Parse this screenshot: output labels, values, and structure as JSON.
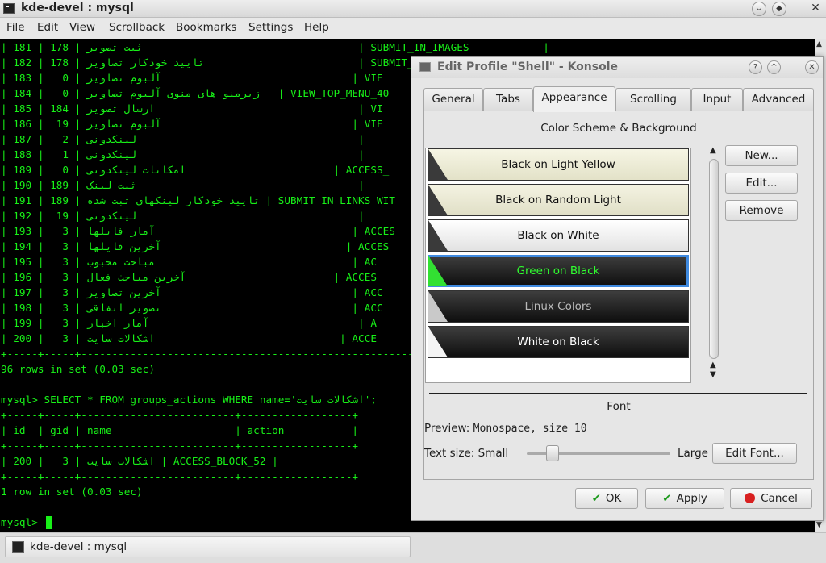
{
  "window": {
    "title": "kde-devel : mysql"
  },
  "menu": [
    "File",
    "Edit",
    "View",
    "Scrollback",
    "Bookmarks",
    "Settings",
    "Help"
  ],
  "terminal": {
    "lines": [
      "| 181 | 178 | ثبت تصویر                                   | SUBMIT_IN_IMAGES            |",
      "| 182 | 178 | تایید خودکار تصاویر                         | SUBMIT_IN_",
      "| 183 |   0 | آلبوم تصاویر                               | VIE",
      "| 184 |   0 | زیرمنو های منوی آلبوم تصاویر   | VIEW_TOP_MENU_40",
      "| 185 | 184 | ارسال تصویر                                 | VI",
      "| 186 |  19 | آلبوم تصاویر                               | VIE",
      "| 187 |   2 | لینکدونی                                    |",
      "| 188 |   1 | لینکدونی                                    |",
      "| 189 |   0 | امکانات لینکدونی                        | ACCESS_",
      "| 190 | 189 | ثبت لینک                                    |",
      "| 191 | 189 | تایید خودکار لینکهای ثبت شده | SUBMIT_IN_LINKS_WIT",
      "| 192 |  19 | لینکدونی                                    |",
      "| 193 |   3 | آمار فایلها                                | ACCES",
      "| 194 |   3 | آخرین فایلها                              | ACCES",
      "| 195 |   3 | مباحث محبوب                                | AC",
      "| 196 |   3 | آخرین مباحث فعال                        | ACCES",
      "| 197 |   3 | آخرین تصاویر                               | ACC",
      "| 198 |   3 | تصویر اتفاقی                               | ACC",
      "| 199 |   3 | آمار اخبار                                  | A",
      "| 200 |   3 | اشکالات سایت                              | ACCE",
      "+-----+-----+------------------------------------------------------------------",
      "96 rows in set (0.03 sec)",
      "",
      "mysql> SELECT * FROM groups_actions WHERE name='اشکالات سایت';",
      "+-----+-----+-------------------------+------------------+",
      "| id  | gid | name                    | action           |",
      "+-----+-----+-------------------------+------------------+",
      "| 200 |   3 | اشکالات سایت | ACCESS_BLOCK_52 |",
      "+-----+-----+-------------------------+------------------+",
      "1 row in set (0.03 sec)",
      "",
      "mysql> "
    ]
  },
  "taskbar": {
    "task_label": "kde-devel : mysql"
  },
  "dialog": {
    "title": "Edit Profile \"Shell\" - Konsole",
    "tabs": [
      "General",
      "Tabs",
      "Appearance",
      "Scrolling",
      "Input",
      "Advanced"
    ],
    "active_tab": "Appearance",
    "color_section_title": "Color Scheme & Background",
    "schemes": [
      "Black on Light Yellow",
      "Black on Random Light",
      "Black on White",
      "Green on Black",
      "Linux Colors",
      "White on Black"
    ],
    "selected_scheme": "Green on Black",
    "buttons": {
      "new": "New...",
      "edit": "Edit...",
      "remove": "Remove"
    },
    "font_section_title": "Font",
    "preview_label": "Preview:",
    "preview_value": "Monospace, size 10",
    "text_size_label": "Text size: Small",
    "text_size_large": "Large",
    "text_size_level": 0.18,
    "edit_font": "Edit Font...",
    "footer": {
      "ok": "OK",
      "apply": "Apply",
      "cancel": "Cancel"
    }
  },
  "colors": {
    "terminal_fg": "#18f018",
    "terminal_bg": "#000000",
    "selection": "#3f8ae0"
  }
}
